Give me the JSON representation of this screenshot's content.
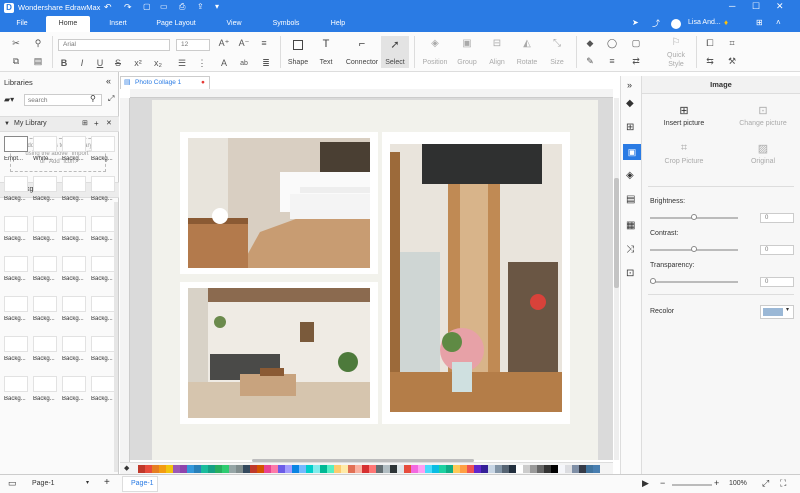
{
  "app": {
    "title": "Wondershare EdrawMax",
    "user": "Lisa And..."
  },
  "tabs": [
    "File",
    "Home",
    "Insert",
    "Page Layout",
    "View",
    "Symbols",
    "Help"
  ],
  "ribbon": {
    "font_name": "Arial",
    "font_size": "12",
    "shape": "Shape",
    "text": "Text",
    "connector": "Connector",
    "select": "Select",
    "position": "Position",
    "group": "Group",
    "align": "Align",
    "rotate": "Rotate",
    "size": "Size",
    "quick_style_1": "Quick",
    "quick_style_2": "Style"
  },
  "libraries": {
    "title": "Libraries",
    "search_placeholder": "search",
    "my_library": "My Library",
    "add_hint": [
      "Add symbols to the library",
      "using the above \"Import\"",
      "or \"Add\" icon."
    ],
    "backgrounds": "Backgrounds",
    "thumb_labels_row1": [
      "Empt...",
      "White...",
      "Backg...",
      "Backg..."
    ],
    "thumb_label": "Backg..."
  },
  "document": {
    "tab_name": "Photo Collage 1"
  },
  "panel": {
    "title": "Image",
    "insert_picture": "Insert picture",
    "change_picture": "Change picture",
    "crop_picture": "Crop Picture",
    "original": "Original",
    "brightness": "Brightness:",
    "contrast": "Contrast:",
    "transparency": "Transparency:",
    "brightness_value": "0",
    "contrast_value": "0",
    "transparency_value": "0",
    "recolor": "Recolor"
  },
  "status": {
    "page_select": "Page-1",
    "page_tab": "Page-1",
    "zoom": "100%",
    "add": "+"
  },
  "palette_colors": [
    "#c0392b",
    "#e74c3c",
    "#e67e22",
    "#f39c12",
    "#f1c40f",
    "#9b59b6",
    "#8e44ad",
    "#3498db",
    "#2980b9",
    "#1abc9c",
    "#16a085",
    "#27ae60",
    "#2ecc71",
    "#95a5a6",
    "#7f8c8d",
    "#34495e",
    "#c0392b",
    "#d35400",
    "#e84393",
    "#fd79a8",
    "#6c5ce7",
    "#a29bfe",
    "#0984e3",
    "#74b9ff",
    "#00cec9",
    "#81ecec",
    "#00b894",
    "#55efc4",
    "#fdcb6e",
    "#ffeaa7",
    "#e17055",
    "#fab1a0",
    "#d63031",
    "#ff7675",
    "#636e72",
    "#b2bec3",
    "#2d3436",
    "#dfe6e9",
    "#e74c3c",
    "#f368e0",
    "#ff9ff3",
    "#48dbfb",
    "#0abde3",
    "#1dd1a1",
    "#10ac84",
    "#feca57",
    "#ff9f43",
    "#ee5253",
    "#5f27cd",
    "#341f97",
    "#c8d6e5",
    "#8395a7",
    "#576574",
    "#222f3e",
    "#ffffff",
    "#cccccc",
    "#999999",
    "#666666",
    "#333333",
    "#000000",
    "#f5f6fa",
    "#dcdde1",
    "#7f8fa6",
    "#353b48",
    "#40739e",
    "#487eb0"
  ]
}
